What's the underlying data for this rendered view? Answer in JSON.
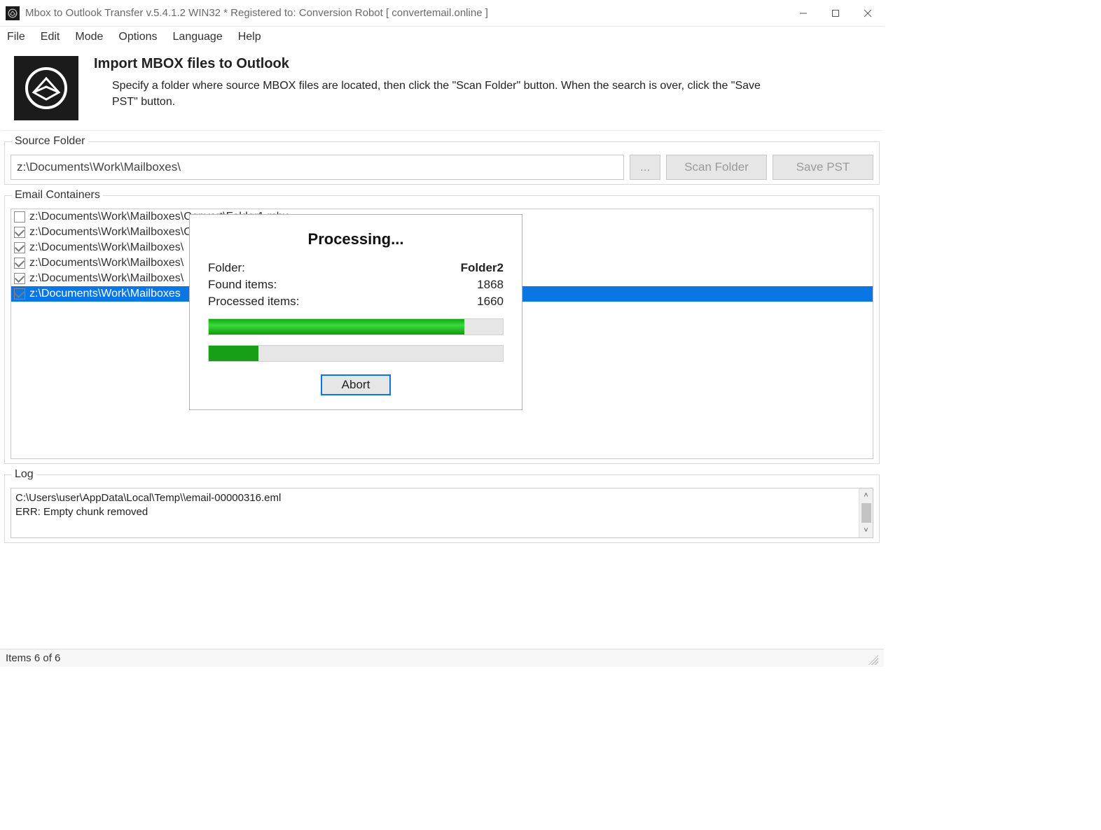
{
  "window": {
    "title": "Mbox to Outlook Transfer v.5.4.1.2 WIN32 * Registered to: Conversion Robot [ convertemail.online ]"
  },
  "menu": {
    "items": [
      "File",
      "Edit",
      "Mode",
      "Options",
      "Language",
      "Help"
    ]
  },
  "header": {
    "title": "Import MBOX files to Outlook",
    "description": "Specify a folder where source MBOX files are located, then click the \"Scan Folder\" button. When the search is over, click the \"Save PST\" button."
  },
  "sourceFolder": {
    "legend": "Source Folder",
    "path": "z:\\Documents\\Work\\Mailboxes\\",
    "browse": "...",
    "scan": "Scan Folder",
    "save": "Save PST"
  },
  "containers": {
    "legend": "Email Containers",
    "items": [
      {
        "checked": false,
        "selected": false,
        "path": "z:\\Documents\\Work\\Mailboxes\\Convert\\Folder1.mbx"
      },
      {
        "checked": true,
        "selected": false,
        "path": "z:\\Documents\\Work\\Mailboxes\\Convert\\Folder2.mbx"
      },
      {
        "checked": true,
        "selected": false,
        "path": "z:\\Documents\\Work\\Mailboxes\\"
      },
      {
        "checked": true,
        "selected": false,
        "path": "z:\\Documents\\Work\\Mailboxes\\"
      },
      {
        "checked": true,
        "selected": false,
        "path": "z:\\Documents\\Work\\Mailboxes\\"
      },
      {
        "checked": true,
        "selected": true,
        "path": "z:\\Documents\\Work\\Mailboxes"
      }
    ]
  },
  "log": {
    "legend": "Log",
    "lines": [
      "C:\\Users\\user\\AppData\\Local\\Temp\\\\email-00000316.eml",
      "ERR: Empty chunk removed"
    ]
  },
  "status": {
    "text": "Items 6 of 6"
  },
  "dialog": {
    "title": "Processing...",
    "labels": {
      "folder": "Folder:",
      "found": "Found items:",
      "processed": "Processed items:"
    },
    "folder": "Folder2",
    "found": "1868",
    "processed": "1660",
    "progress1_pct": 87,
    "progress2_pct": 17,
    "abort": "Abort"
  }
}
